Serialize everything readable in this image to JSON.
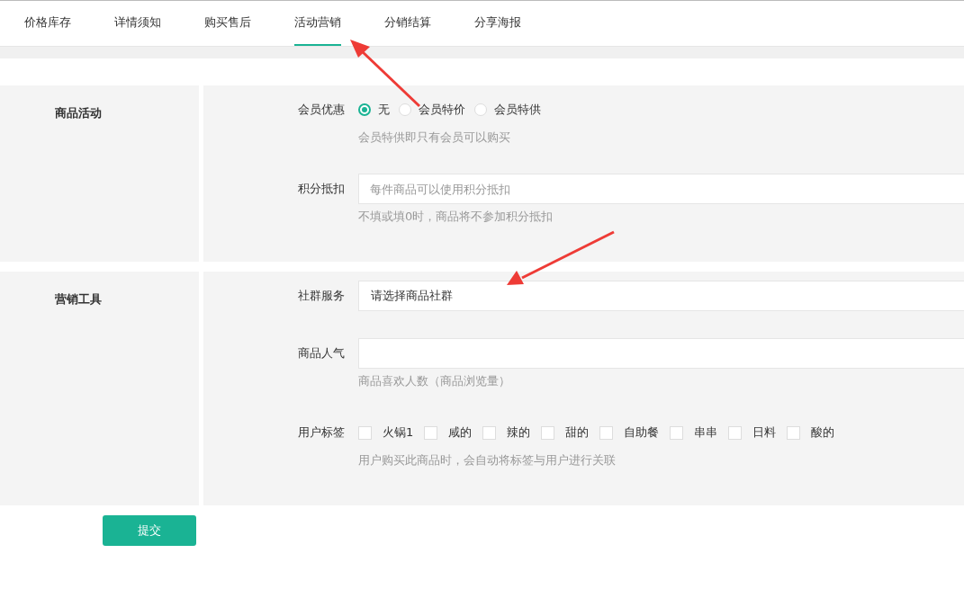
{
  "tabs": [
    {
      "label": "价格库存",
      "selected": false
    },
    {
      "label": "详情须知",
      "selected": false
    },
    {
      "label": "购买售后",
      "selected": false
    },
    {
      "label": "活动营销",
      "selected": true
    },
    {
      "label": "分销结算",
      "selected": false
    },
    {
      "label": "分享海报",
      "selected": false
    }
  ],
  "sections": [
    {
      "title": "商品活动",
      "fields": [
        {
          "kind": "radio",
          "label": "会员优惠",
          "options": [
            {
              "label": "无",
              "selected": true
            },
            {
              "label": "会员特价",
              "selected": false
            },
            {
              "label": "会员特供",
              "selected": false
            }
          ],
          "hint": "会员特供即只有会员可以购买"
        },
        {
          "kind": "input",
          "label": "积分抵扣",
          "placeholder": "每件商品可以使用积分抵扣",
          "hint": "不填或填0时，商品将不参加积分抵扣"
        }
      ]
    },
    {
      "title": "营销工具",
      "fields": [
        {
          "kind": "select",
          "label": "社群服务",
          "value": "请选择商品社群"
        },
        {
          "kind": "input",
          "label": "商品人气",
          "hint": "商品喜欢人数（商品浏览量）"
        },
        {
          "kind": "checkbox",
          "label": "用户标签",
          "options": [
            {
              "label": "火锅1",
              "checked": false
            },
            {
              "label": "咸的",
              "checked": false
            },
            {
              "label": "辣的",
              "checked": false
            },
            {
              "label": "甜的",
              "checked": false
            },
            {
              "label": "自助餐",
              "checked": false
            },
            {
              "label": "串串",
              "checked": false
            },
            {
              "label": "日料",
              "checked": false
            },
            {
              "label": "酸的",
              "checked": false
            }
          ],
          "hint": "用户购买此商品时，会自动将标签与用户进行关联"
        }
      ]
    }
  ],
  "submit_button": "提交"
}
